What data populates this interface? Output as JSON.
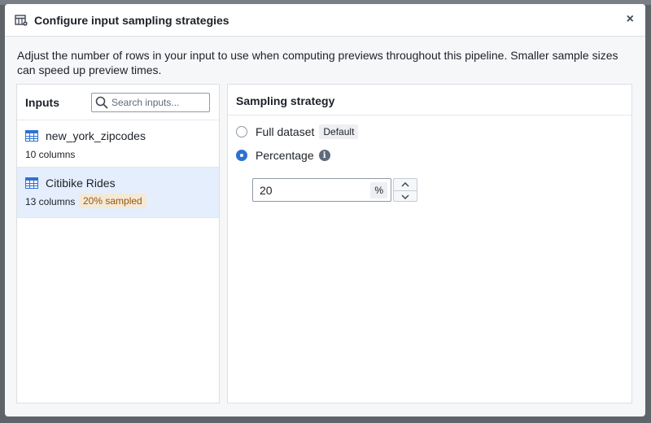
{
  "dialog": {
    "title": "Configure input sampling strategies",
    "close_glyph": "×",
    "description": "Adjust the number of rows in your input to use when computing previews throughout this pipeline. Smaller sample sizes can speed up preview times."
  },
  "inputs_panel": {
    "heading": "Inputs",
    "search_placeholder": "Search inputs...",
    "items": [
      {
        "name": "new_york_zipcodes",
        "meta": "10 columns",
        "badge": "",
        "icon": "table-icon"
      },
      {
        "name": "Citibike Rides",
        "meta": "13 columns",
        "badge": "20% sampled",
        "icon": "table-icon",
        "selected": true
      }
    ]
  },
  "strategy_panel": {
    "heading": "Sampling strategy",
    "options": [
      {
        "label": "Full dataset",
        "tag": "Default",
        "checked": false
      },
      {
        "label": "Percentage",
        "info_glyph": "i",
        "checked": true
      }
    ],
    "percentage_value": "20",
    "unit": "%"
  },
  "colors": {
    "accent": "#2d72d2",
    "selected_row": "#e4eefc",
    "badge_text": "#935610",
    "badge_bg": "#f5e9d6"
  }
}
